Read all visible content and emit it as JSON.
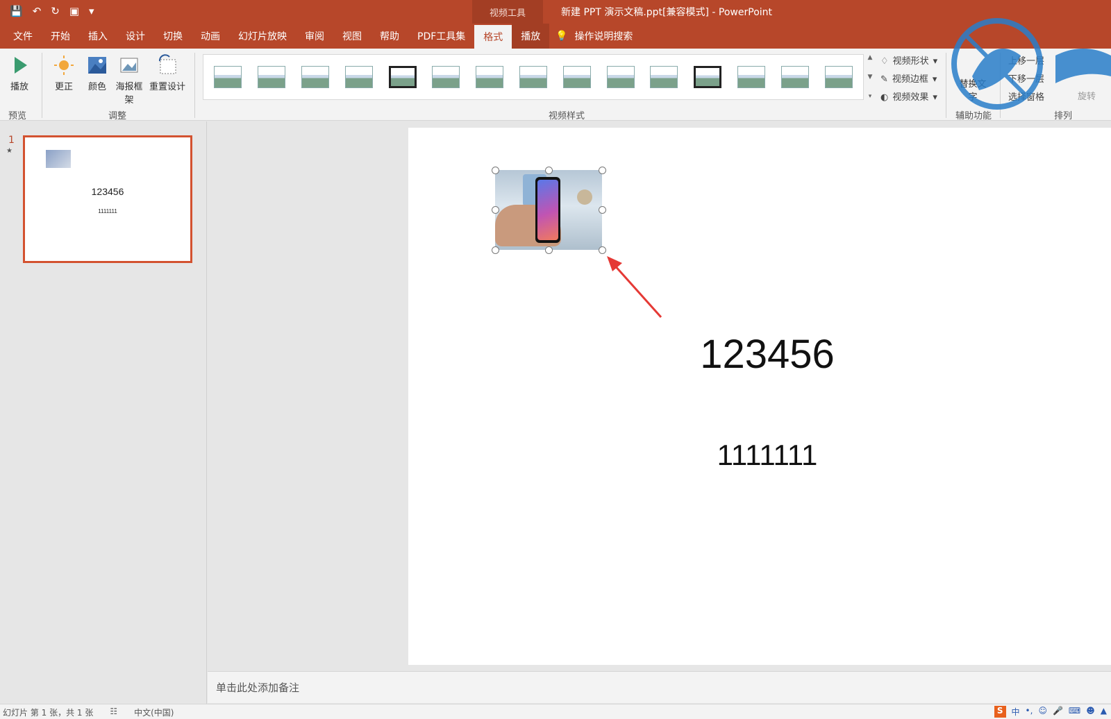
{
  "title_bar": {
    "context_tab": "视频工具",
    "document_title": "新建 PPT 演示文稿.ppt[兼容模式] - PowerPoint"
  },
  "tabs": [
    "文件",
    "开始",
    "插入",
    "设计",
    "切换",
    "动画",
    "幻灯片放映",
    "审阅",
    "视图",
    "帮助",
    "PDF工具集",
    "格式",
    "播放"
  ],
  "active_tab": "格式",
  "tell_me": "操作说明搜索",
  "ribbon": {
    "preview_group": {
      "label": "预览",
      "play": "播放"
    },
    "adjust_group": {
      "label": "调整",
      "correct": "更正",
      "color": "颜色",
      "poster": "海报框架",
      "reset": "重置设计"
    },
    "styles_group": {
      "label": "视频样式",
      "shape": "视频形状",
      "border": "视频边框",
      "effects": "视频效果"
    },
    "accessibility_group": {
      "label": "辅助功能",
      "alt_text": "替换文字"
    },
    "arrange_group": {
      "label": "排列",
      "bring_forward": "上移一层",
      "send_backward": "下移一层",
      "selection_pane": "选择窗格",
      "rotate": "旋转"
    }
  },
  "slide_pane": {
    "slide_number": "1",
    "thumb_text_big": "123456",
    "thumb_text_small": "1111111"
  },
  "slide": {
    "text_big": "123456",
    "text_small": "1111111"
  },
  "notes": {
    "placeholder": "单击此处添加备注"
  },
  "status_bar": {
    "slide_info": "幻灯片 第 1 张，共 1 张",
    "language": "中文(中国)",
    "tray_ime": "中"
  },
  "colors": {
    "accent": "#b7472a",
    "selection": "#d35230"
  }
}
